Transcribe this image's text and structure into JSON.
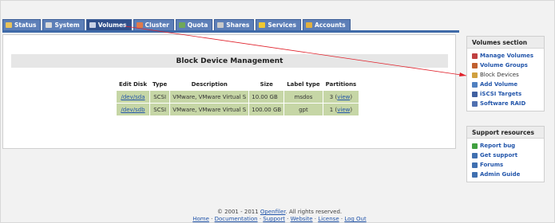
{
  "tabs": [
    {
      "label": "Status",
      "icon": "status-icon",
      "color": "#e8c25a"
    },
    {
      "label": "System",
      "icon": "system-icon",
      "color": "#d9d9d9"
    },
    {
      "label": "Volumes",
      "icon": "volumes-icon",
      "color": "#c9d2e6"
    },
    {
      "label": "Cluster",
      "icon": "cluster-icon",
      "color": "#e07a4a"
    },
    {
      "label": "Quota",
      "icon": "quota-icon",
      "color": "#6fa85a"
    },
    {
      "label": "Shares",
      "icon": "shares-icon",
      "color": "#c9c9c9"
    },
    {
      "label": "Services",
      "icon": "services-icon",
      "color": "#f0c830"
    },
    {
      "label": "Accounts",
      "icon": "accounts-icon",
      "color": "#e0b040"
    }
  ],
  "active_tab": "Volumes",
  "main": {
    "heading": "Block Device Management",
    "columns": [
      "Edit Disk",
      "Type",
      "Description",
      "Size",
      "Label type",
      "Partitions"
    ],
    "rows": [
      {
        "disk": "/dev/sda",
        "type": "SCSI",
        "description": "VMware, VMware Virtual S",
        "size": "10.00 GB",
        "label_type": "msdos",
        "partitions_count": "3",
        "partitions_link": "view"
      },
      {
        "disk": "/dev/sdb",
        "type": "SCSI",
        "description": "VMware, VMware Virtual S",
        "size": "100.00 GB",
        "label_type": "gpt",
        "partitions_count": "1",
        "partitions_link": "view"
      }
    ]
  },
  "volumes_section": {
    "title": "Volumes section",
    "items": [
      {
        "label": "Manage Volumes",
        "icon": "manage-volumes-icon",
        "color": "#c04040"
      },
      {
        "label": "Volume Groups",
        "icon": "volume-groups-icon",
        "color": "#c06030"
      },
      {
        "label": "Block Devices",
        "icon": "block-devices-icon",
        "color": "#d0a040"
      },
      {
        "label": "Add Volume",
        "icon": "add-volume-icon",
        "color": "#5080c0"
      },
      {
        "label": "iSCSI Targets",
        "icon": "iscsi-targets-icon",
        "color": "#4060a0"
      },
      {
        "label": "Software RAID",
        "icon": "software-raid-icon",
        "color": "#5070b0"
      }
    ]
  },
  "support_resources": {
    "title": "Support resources",
    "items": [
      {
        "label": "Report bug",
        "icon": "report-bug-icon",
        "color": "#40a040"
      },
      {
        "label": "Get support",
        "icon": "get-support-icon",
        "color": "#4070b0"
      },
      {
        "label": "Forums",
        "icon": "forums-icon",
        "color": "#4070b0"
      },
      {
        "label": "Admin Guide",
        "icon": "admin-guide-icon",
        "color": "#4070b0"
      }
    ]
  },
  "footer": {
    "copyright_prefix": "© 2001 - 2011 ",
    "brand_link": "Openfiler",
    "copyright_suffix": ". All rights reserved.",
    "links": [
      "Home",
      "Documentation",
      "Support",
      "Website",
      "License",
      "Log Out"
    ],
    "separator": " · "
  },
  "annotation_arrow_color": "#e0202a"
}
